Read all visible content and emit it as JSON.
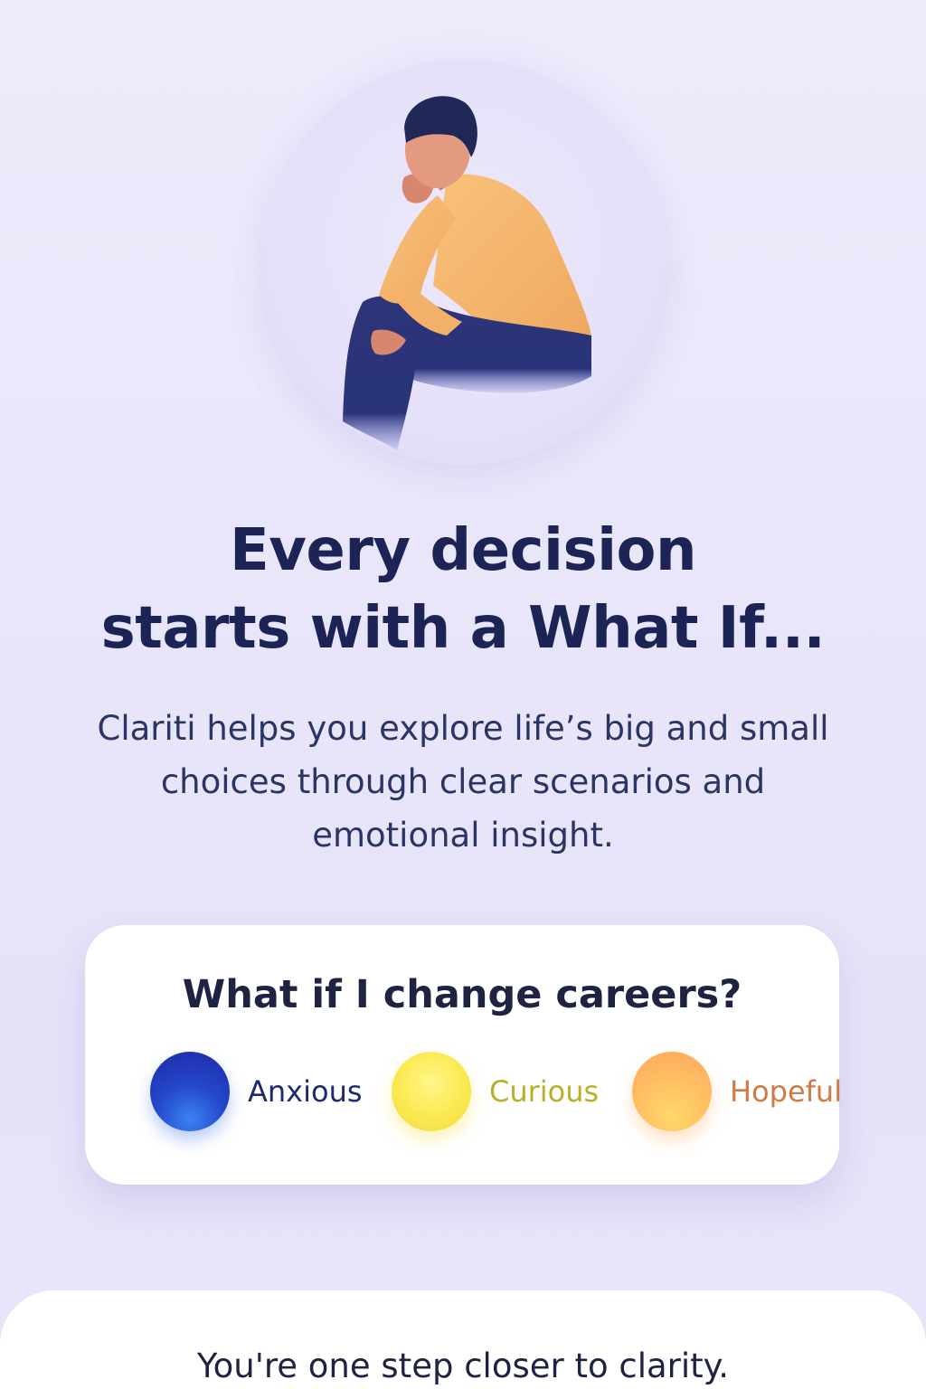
{
  "hero": {
    "illustration": "person-thinking-illustration"
  },
  "headline": {
    "line1": "Every decision",
    "line2": "starts with a What If..."
  },
  "subtext": {
    "line1": "Clariti helps you explore life’s big and small",
    "line2": "choices through clear scenarios and",
    "line3": "emotional insight."
  },
  "scenario_card": {
    "question": "What if I change careers?",
    "emotions": [
      {
        "label": "Anxious",
        "color": "#1f2a6b",
        "orb_color": "#2347c9"
      },
      {
        "label": "Curious",
        "color": "#b9b02a",
        "orb_color": "#fbea55"
      },
      {
        "label": "Hopeful",
        "color": "#d07a45",
        "orb_color": "#ffb562"
      }
    ]
  },
  "bottom_sheet": {
    "message": "You're one step closer to clarity."
  }
}
